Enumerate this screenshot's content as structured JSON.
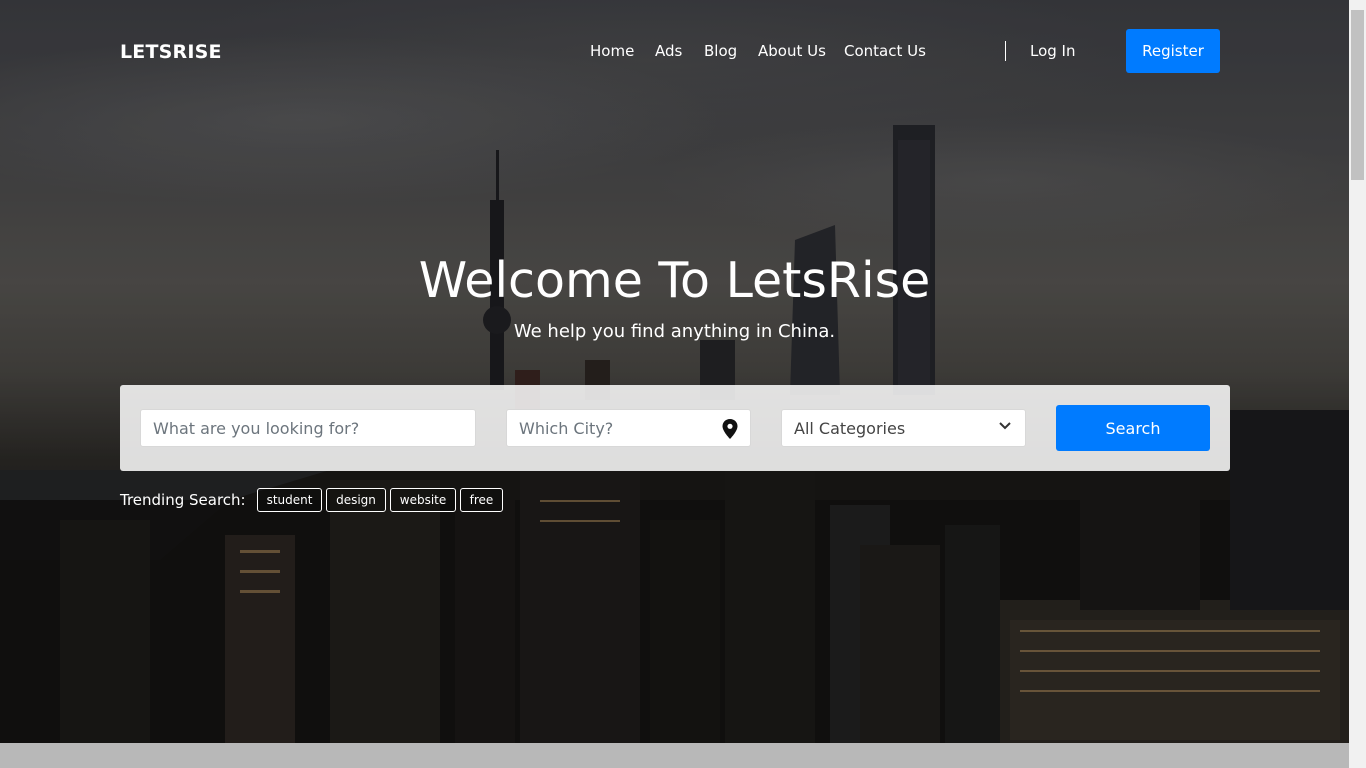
{
  "brand": "LETSRISE",
  "nav": {
    "home": "Home",
    "ads": "Ads",
    "blog": "Blog",
    "about": "About Us",
    "contact": "Contact Us",
    "login": "Log In",
    "register": "Register"
  },
  "hero": {
    "title": "Welcome To LetsRise",
    "subtitle": "We help you find anything in China."
  },
  "search": {
    "keyword_placeholder": "What are you looking for?",
    "city_placeholder": "Which City?",
    "category_selected": "All Categories",
    "button": "Search"
  },
  "trending": {
    "label": "Trending Search:",
    "tags": [
      "student",
      "design",
      "website",
      "free"
    ]
  },
  "colors": {
    "accent": "#007bff"
  },
  "icons": {
    "city": "map-pin-icon",
    "category": "chevron-down-icon"
  }
}
